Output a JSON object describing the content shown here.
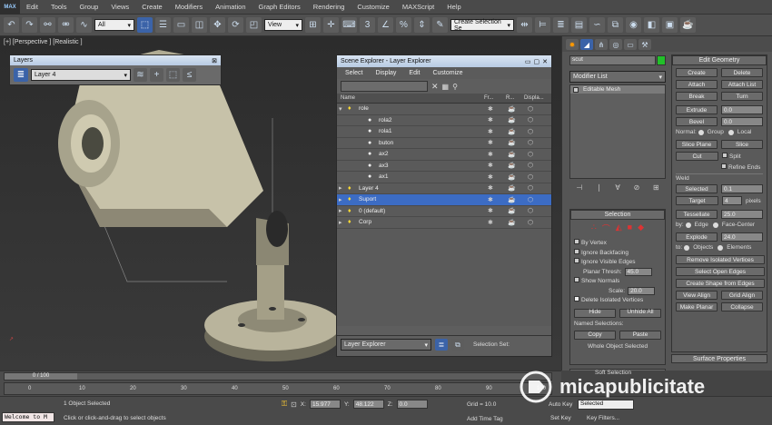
{
  "menu": {
    "logo": "MAX",
    "items": [
      "Edit",
      "Tools",
      "Group",
      "Views",
      "Create",
      "Modifiers",
      "Animation",
      "Graph Editors",
      "Rendering",
      "Customize",
      "MAXScript",
      "Help"
    ]
  },
  "toolbar": {
    "filter": "All",
    "refcoord": "View",
    "selection_set": "Create Selection Se"
  },
  "viewport": {
    "label": "[+] [Perspective ] [Realistic ]"
  },
  "layers": {
    "title": "Layers",
    "current_layer": "Layer 4"
  },
  "scene_explorer": {
    "title": "Scene Explorer - Layer Explorer",
    "menu": [
      "Select",
      "Display",
      "Edit",
      "Customize"
    ],
    "columns": [
      "Name",
      "Fr...",
      "R...",
      "Displa..."
    ],
    "rows": [
      {
        "name": "role",
        "depth": 0,
        "expanded": true
      },
      {
        "name": "rola2",
        "depth": 1
      },
      {
        "name": "rola1",
        "depth": 1
      },
      {
        "name": "buton",
        "depth": 1
      },
      {
        "name": "ax2",
        "depth": 1
      },
      {
        "name": "ax3",
        "depth": 1
      },
      {
        "name": "ax1",
        "depth": 1
      },
      {
        "name": "Layer 4",
        "depth": 0
      },
      {
        "name": "Suport",
        "depth": 0,
        "selected": true
      },
      {
        "name": "0 (default)",
        "depth": 0
      },
      {
        "name": "Corp",
        "depth": 0
      }
    ],
    "footer_dropdown": "Layer Explorer",
    "footer_label": "Selection Set:"
  },
  "command_panel": {
    "object_name": "scut",
    "object_color": "#22c02a",
    "modifier_list": "Modifier List",
    "stack_item": "Editable Mesh",
    "selection": {
      "title": "Selection",
      "by_vertex": "By Vertex",
      "ignore_backfacing": "Ignore Backfacing",
      "ignore_visible_edges": "Ignore Visible Edges",
      "planar_thresh_label": "Planar Thresh:",
      "planar_thresh": "45.0",
      "show_normals": "Show Normals",
      "scale_label": "Scale:",
      "scale": "20.0",
      "delete_isolated": "Delete Isolated Vertices",
      "hide": "Hide",
      "unhide_all": "Unhide All",
      "named_selections": "Named Selections:",
      "copy": "Copy",
      "paste": "Paste",
      "status": "Whole Object Selected"
    },
    "soft_selection": "Soft Selection",
    "edit_geometry": {
      "title": "Edit Geometry",
      "create": "Create",
      "delete": "Delete",
      "attach": "Attach",
      "attach_list": "Attach List",
      "break": "Break",
      "turn": "Turn",
      "extrude": "Extrude",
      "extrude_val": "0.0",
      "bevel": "Bevel",
      "bevel_val": "0.0",
      "normal_label": "Normal:",
      "group": "Group",
      "local": "Local",
      "slice_plane": "Slice Plane",
      "slice": "Slice",
      "cut": "Cut",
      "split": "Split",
      "refine_ends": "Refine Ends",
      "weld": "Weld",
      "selected": "Selected",
      "selected_val": "0.1",
      "target": "Target",
      "target_val": "4",
      "pixels": "pixels",
      "tessellate": "Tessellate",
      "tess_val": "25.0",
      "by_label": "by:",
      "edge": "Edge",
      "face_center": "Face-Center",
      "explode": "Explode",
      "explode_val": "24.0",
      "to_label": "to:",
      "objects": "Objects",
      "elements": "Elements",
      "remove_isolated": "Remove Isolated Vertices",
      "select_open_edges": "Select Open Edges",
      "create_shape": "Create Shape from Edges",
      "view_align": "View Align",
      "grid_align": "Grid Align",
      "make_planar": "Make Planar",
      "collapse": "Collapse"
    },
    "surface_properties": "Surface Properties"
  },
  "timeline": {
    "frame": "0 / 100",
    "ticks": [
      "0",
      "10",
      "20",
      "30",
      "40",
      "50",
      "60",
      "70",
      "80",
      "90",
      "100"
    ]
  },
  "status": {
    "maxscript": "Welcome to M",
    "objects_selected": "1 Object Selected",
    "prompt": "Click or click-and-drag to select objects",
    "x_label": "X:",
    "x": "15.977",
    "y_label": "Y:",
    "y": "48.122",
    "z_label": "Z:",
    "z": "0.0",
    "grid": "Grid = 10.0",
    "add_time_tag": "Add Time Tag",
    "auto_key": "Auto Key",
    "selected": "Selected",
    "set_key": "Set Key",
    "key_filters": "Key Filters..."
  },
  "watermark": {
    "text": "micapublicitate"
  }
}
